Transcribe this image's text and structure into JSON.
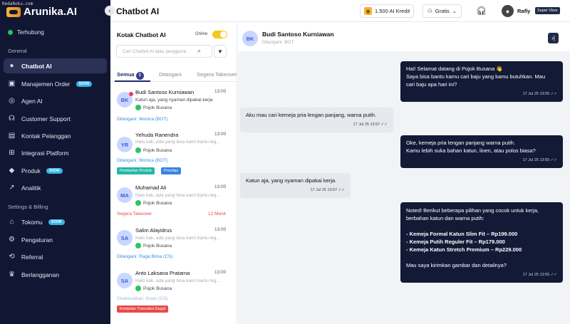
{
  "watermark": "RedaRoku.com",
  "brand": {
    "name": "Arunika.AI"
  },
  "sidebar": {
    "status": "Terhubung",
    "section_general": "General",
    "section_settings": "Settings & Billing",
    "soon_label": "SOON",
    "items": [
      {
        "label": "Chatbot AI",
        "icon": "chat-bot-icon"
      },
      {
        "label": "Manajemen Order",
        "icon": "order-icon"
      },
      {
        "label": "Agen AI",
        "icon": "robot-icon"
      },
      {
        "label": "Customer Support",
        "icon": "support-icon"
      },
      {
        "label": "Kontak Pelanggan",
        "icon": "contacts-icon"
      },
      {
        "label": "Integrasi Platform",
        "icon": "integration-icon"
      },
      {
        "label": "Produk",
        "icon": "product-icon"
      },
      {
        "label": "Analitik",
        "icon": "analytics-icon"
      },
      {
        "label": "Tokomu",
        "icon": "store-icon"
      },
      {
        "label": "Pengaturan",
        "icon": "settings-icon"
      },
      {
        "label": "Referral",
        "icon": "referral-icon"
      },
      {
        "label": "Berlangganan",
        "icon": "crown-icon"
      }
    ]
  },
  "header": {
    "title": "Chatbot AI",
    "credit": "1.500 AI Kredit",
    "plan": "Gratis",
    "user_name": "Rafly",
    "role": "Super Visor"
  },
  "list": {
    "title": "Kotak Chatbot AI",
    "online_label": "Online",
    "search_placeholder": "Cari Chatbot AI atau pengguna",
    "tabs": [
      {
        "label": "Semua",
        "count": "1"
      },
      {
        "label": "Ditangani"
      },
      {
        "label": "Segera Takeover"
      }
    ],
    "conversations": [
      {
        "initials": "BK",
        "name": "Budi Santoso Kurniawan",
        "time": "13:00",
        "preview": "Katun aja, yang nyaman dipakai kerja",
        "source": "Pojok Busana",
        "assign": "Ditangani: Monica (BOT)"
      },
      {
        "initials": "YR",
        "name": "Yehuda Ranendra",
        "time": "13:00",
        "preview": "Halo kak, ada yang bisa kami bantu leg...",
        "source": "Pojok Busana",
        "assign": "Ditangani: Monica (BOT)",
        "tags": [
          "Pembelian Produk",
          "Prioritas"
        ]
      },
      {
        "initials": "MA",
        "name": "Muhamad Ali",
        "time": "13:00",
        "preview": "Halo kak, ada yang bisa kami bantu leg...",
        "source": "Pojok Busana",
        "assign": "Segera Takeover",
        "overtime": "12 Menit"
      },
      {
        "initials": "SA",
        "name": "Salim Alayidrus",
        "time": "13:00",
        "preview": "Halo kak, ada yang bisa kami bantu leg...",
        "source": "Pojok Busana",
        "assign": "Ditangani: Raga Bima (CS)"
      },
      {
        "initials": "SA",
        "name": "Anto Laksana Pratama",
        "time": "13:00",
        "preview": "Halo kak, ada yang bisa kami bantu leg...",
        "source": "Pojok Busana",
        "assign": "Diselesaikan: Ihsan (CS)",
        "tags": [
          "Komplain Transaksi Gagal"
        ]
      }
    ]
  },
  "chat": {
    "initials": "BK",
    "name": "Budi Santoso Kurniawan",
    "handled_by": "Ditangani: BOT",
    "messages": [
      {
        "dir": "out",
        "lines": [
          "Hai! Selamat datang di Pojok Busana 👋",
          "Saya bisa bantu kamu cari baju yang kamu butuhkan. Mau",
          "cari baju apa hari ini?"
        ],
        "time": "17 Jul 25 13:55"
      },
      {
        "dir": "in",
        "lines": [
          "Aku mau cari kemeja pria lengan panjang, warna putih."
        ],
        "time": "17 Jul 25 13:57"
      },
      {
        "dir": "out",
        "lines": [
          "Oke, kemeja pria lengan panjang warna putih.",
          "Kamu lebih suka bahan katun, linen, atau polos biasa?"
        ],
        "time": "17 Jul 25 13:55"
      },
      {
        "dir": "in",
        "lines": [
          "Katun aja, yang nyaman dipakai kerja."
        ],
        "time": "17 Jul 25 13:57"
      },
      {
        "dir": "out",
        "lines": [
          "Noted! Berikut beberapa pilihan yang cocok untuk kerja,",
          "berbahan katun dan warna putih:",
          "",
          "- Kemeja Formal Katun Slim Fit – Rp199.000",
          "- Kemeja Putih Reguler Fit – Rp179.000",
          "- Kemeja Katun Stretch Premium – Rp229.000",
          "",
          "Mau saya kirimkan gambar dan detailnya?"
        ],
        "time": "17 Jul 25 13:55"
      }
    ]
  }
}
